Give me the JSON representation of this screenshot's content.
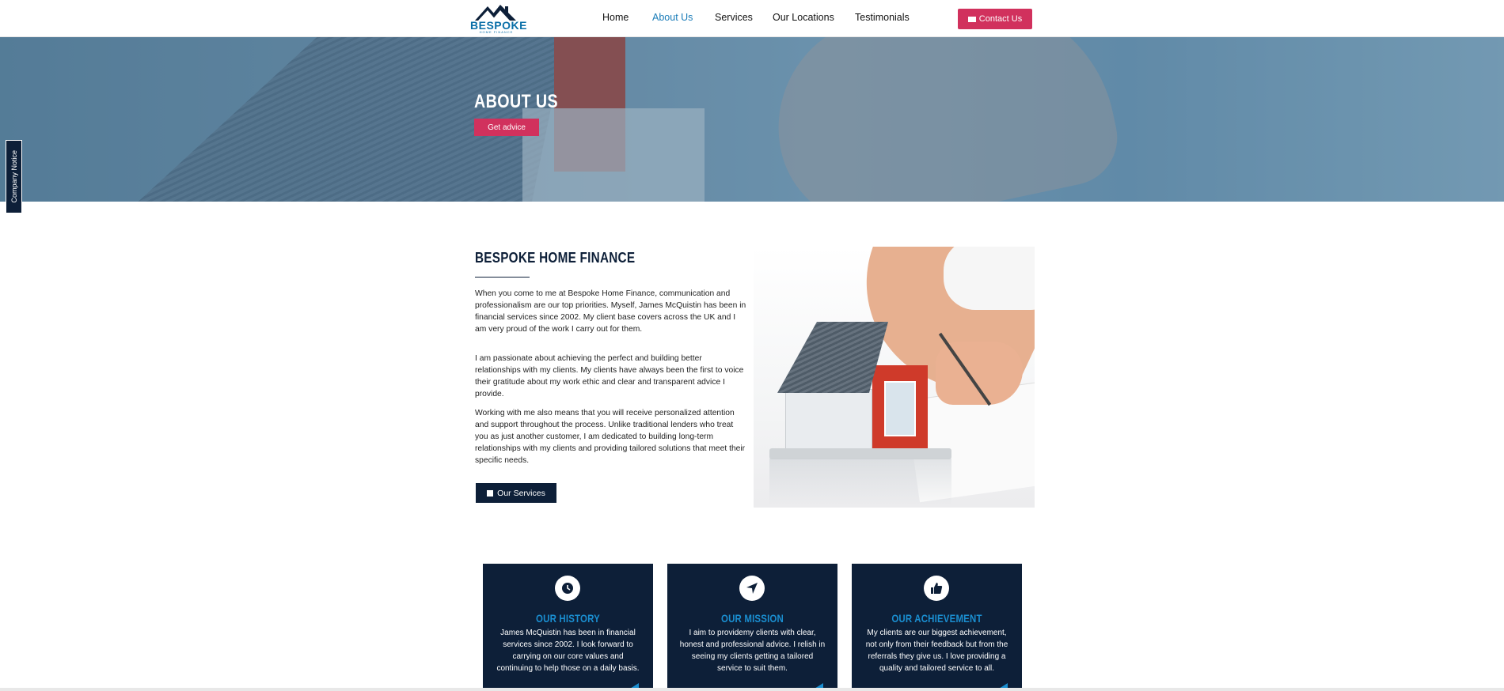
{
  "header": {
    "logo_text": "BESPOKE",
    "logo_sub": "HOME FINANCE",
    "nav": [
      {
        "label": "Home",
        "active": false
      },
      {
        "label": "About Us",
        "active": true
      },
      {
        "label": "Services",
        "active": false
      },
      {
        "label": "Our Locations",
        "active": false
      },
      {
        "label": "Testimonials",
        "active": false
      }
    ],
    "contact_label": "Contact Us"
  },
  "hero": {
    "title": "ABOUT US",
    "cta_label": "Get advice"
  },
  "side_tab": {
    "label": "Company Notice"
  },
  "about": {
    "title": "BESPOKE HOME FINANCE",
    "paragraphs": [
      "When you come to me at Bespoke Home Finance, communication and professionalism are our top priorities. Myself, James McQuistin has been in financial services since 2002. My client base covers across the UK and I am very proud of the work I carry out for them.",
      "I am passionate about achieving the perfect and building better relationships with my clients. My clients have always been the first to voice their gratitude about my work ethic and clear and transparent advice I provide.",
      "Working with me also means that you will receive personalized attention and support throughout the process. Unlike traditional lenders who treat you as just another customer, I am dedicated to building long-term relationships with my clients and providing tailored solutions that meet their specific needs."
    ],
    "button_label": "Our Services"
  },
  "cards": [
    {
      "icon": "clock-icon",
      "title": "OUR HISTORY",
      "text": "James McQuistin has been in financial services since 2002. I look forward to carrying on our core values and continuing to help those on a daily basis."
    },
    {
      "icon": "location-arrow-icon",
      "title": "OUR MISSION",
      "text": "I aim to providemy clients with clear, honest and professional advice. I relish in seeing my clients getting a tailored service to suit them."
    },
    {
      "icon": "thumbs-up-icon",
      "title": "OUR ACHIEVEMENT",
      "text": "My clients are our biggest achievement, not only from their feedback but from the referrals they give us. I love providing a quality and tailored service to all."
    }
  ],
  "colors": {
    "navy": "#0d1f38",
    "accent_pink": "#d1315d",
    "accent_blue": "#1a8ed0",
    "nav_active": "#1a7cb8"
  }
}
